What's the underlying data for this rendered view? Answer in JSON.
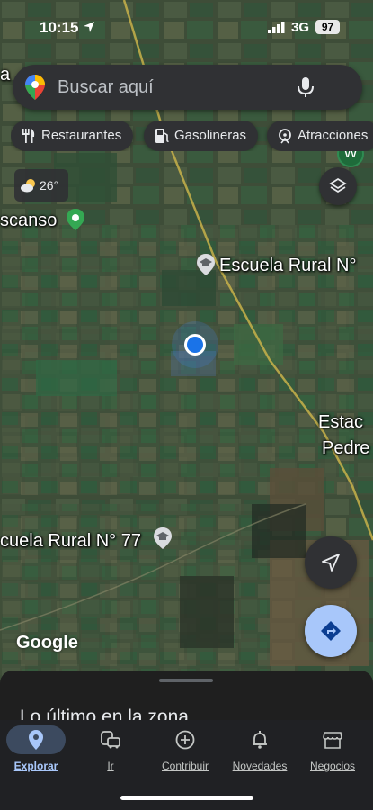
{
  "status_bar": {
    "time": "10:15",
    "network": "3G",
    "battery": "97"
  },
  "search": {
    "placeholder": "Buscar aquí",
    "avatar_letter": "W"
  },
  "chips": [
    {
      "label": "Restaurantes",
      "icon": "fork-knife-icon"
    },
    {
      "label": "Gasolineras",
      "icon": "gas-station-icon"
    },
    {
      "label": "Atracciones",
      "icon": "attractions-icon"
    }
  ],
  "weather": {
    "temp": "26°",
    "icon": "partly-sunny-icon"
  },
  "map": {
    "labels": {
      "descanso": "scanso",
      "escuela_1": "Escuela Rural N°",
      "escuela_77": "cuela Rural N° 77",
      "estacion_line1": "Estac",
      "estacion_line2": "Pedre",
      "a_fragment": "a"
    },
    "logo": "Google"
  },
  "sheet": {
    "title": "Lo último en la zona"
  },
  "bottom_nav": [
    {
      "label": "Explorar",
      "icon": "location-pin-icon",
      "active": true
    },
    {
      "label": "Ir",
      "icon": "commute-icon",
      "active": false
    },
    {
      "label": "Contribuir",
      "icon": "add-circle-icon",
      "active": false
    },
    {
      "label": "Novedades",
      "icon": "bell-icon",
      "active": false
    },
    {
      "label": "Negocios",
      "icon": "storefront-icon",
      "active": false
    }
  ],
  "colors": {
    "accent_blue": "#1a73e8",
    "directions_bg": "#a8c7fa",
    "surface_dark": "#303134",
    "sheet_bg": "#1f1f1f",
    "road_yellow": "#c8b24a"
  }
}
